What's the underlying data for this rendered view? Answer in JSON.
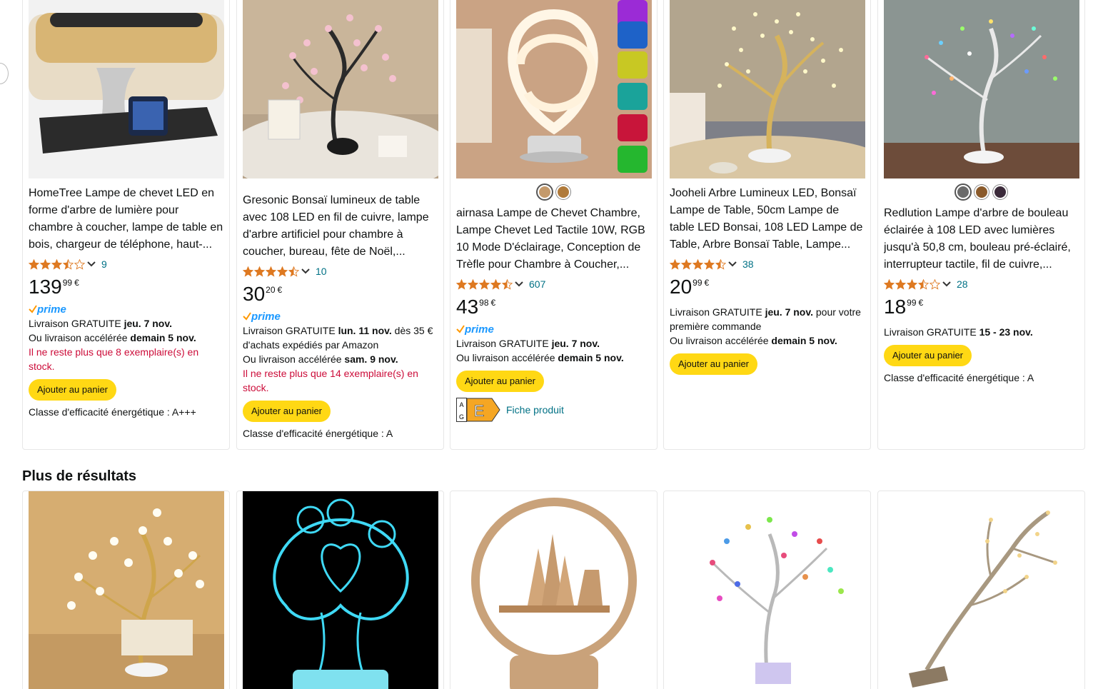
{
  "products": [
    {
      "title": "HomeTree Lampe de chevet LED en forme d'arbre de lumière pour chambre à coucher, lampe de table en bois, chargeur de téléphone, haut-...",
      "rating": 3.5,
      "review_count": "9",
      "price_whole": "139",
      "price_fraction": "99",
      "currency": "€",
      "prime": true,
      "delivery_label": "Livraison GRATUITE",
      "delivery_date": "jeu. 7 nov.",
      "delivery_suffix": "",
      "fast_label": "Ou livraison accélérée",
      "fast_date": "demain 5 nov.",
      "stock_notice": "Il ne reste plus que 8 exemplaire(s) en stock.",
      "add_to_cart": "Ajouter au panier",
      "energy_class": "Classe d'efficacité énergétique : A+++"
    },
    {
      "title": "Gresonic Bonsaï lumineux de table avec 108 LED en fil de cuivre, lampe d'arbre artificiel pour chambre à coucher, bureau, fête de Noël,...",
      "rating": 4.5,
      "review_count": "10",
      "price_whole": "30",
      "price_fraction": "20",
      "currency": "€",
      "prime": true,
      "delivery_label": "Livraison GRATUITE",
      "delivery_date": "lun. 11 nov.",
      "delivery_suffix": "dès 35 € d'achats expédiés par Amazon",
      "fast_label": "Ou livraison accélérée",
      "fast_date": "sam. 9 nov.",
      "stock_notice": "Il ne reste plus que 14 exemplaire(s) en stock.",
      "add_to_cart": "Ajouter au panier",
      "energy_class": "Classe d'efficacité énergétique : A"
    },
    {
      "title": "airnasa Lampe de Chevet Chambre, Lampe Chevet Led Tactile 10W, RGB 10 Mode D'éclairage, Conception de Trèfle pour Chambre à Coucher,...",
      "rating": 4.5,
      "review_count": "607",
      "price_whole": "43",
      "price_fraction": "98",
      "currency": "€",
      "prime": true,
      "swatches": [
        "#c49a6c",
        "#b07a3a"
      ],
      "delivery_label": "Livraison GRATUITE",
      "delivery_date": "jeu. 7 nov.",
      "delivery_suffix": "",
      "fast_label": "Ou livraison accélérée",
      "fast_date": "demain 5 nov.",
      "stock_notice": "",
      "add_to_cart": "Ajouter au panier",
      "energy_label": "E",
      "energy_scale": "A G",
      "fiche_produit": "Fiche produit"
    },
    {
      "title": "Jooheli Arbre Lumineux LED, Bonsaï Lampe de Table, 50cm Lampe de table LED Bonsai, 108 LED Lampe de Table, Arbre Bonsaï Table, Lampe...",
      "rating": 4.5,
      "review_count": "38",
      "price_whole": "20",
      "price_fraction": "99",
      "currency": "€",
      "prime": false,
      "delivery_label": "Livraison GRATUITE",
      "delivery_date": "jeu. 7 nov.",
      "delivery_suffix": "pour votre première commande",
      "fast_label": "Ou livraison accélérée",
      "fast_date": "demain 5 nov.",
      "stock_notice": "",
      "add_to_cart": "Ajouter au panier",
      "energy_class": ""
    },
    {
      "title": "Redlution Lampe d'arbre de bouleau éclairée à 108 LED avec lumières jusqu'à 50,8 cm, bouleau pré-éclairé, interrupteur tactile, fil de cuivre,...",
      "rating": 3.5,
      "review_count": "28",
      "price_whole": "18",
      "price_fraction": "99",
      "currency": "€",
      "prime": false,
      "swatches": [
        "#6b6b6b",
        "#8a5a2b",
        "#3b2a3a"
      ],
      "delivery_label": "Livraison GRATUITE",
      "delivery_date": "15 - 23 nov.",
      "delivery_suffix": "",
      "fast_label": "",
      "fast_date": "",
      "stock_notice": "",
      "add_to_cart": "Ajouter au panier",
      "energy_class": "Classe d'efficacité énergétique : A"
    }
  ],
  "prime_label": "prime",
  "section_title": "Plus de résultats",
  "colors": {
    "star": "#de7921",
    "link": "#007185",
    "stock": "#cc0c39",
    "button": "#ffd814",
    "prime": "#1a98ff"
  }
}
